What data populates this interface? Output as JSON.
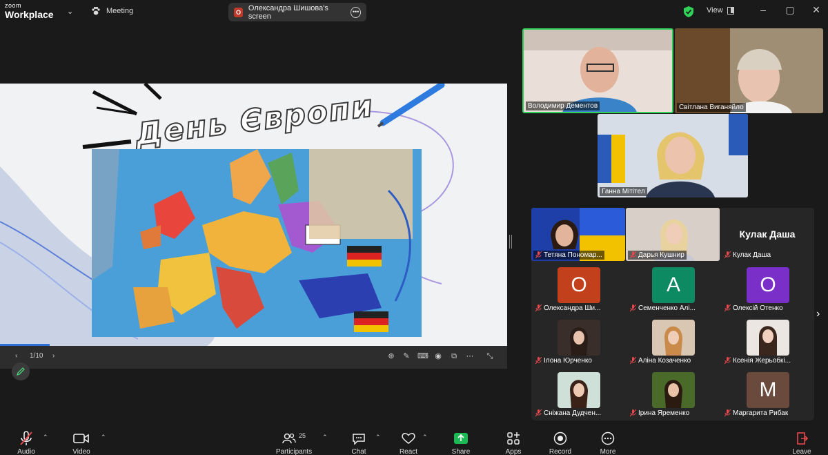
{
  "titlebar": {
    "logo_top": "zoom",
    "logo_bottom": "Workplace",
    "meeting_label": "Meeting",
    "share_badge": "O",
    "share_label": "Олександра Шишова's screen",
    "view_label": "View",
    "security_color": "#30d158"
  },
  "slide": {
    "title": "День Європи",
    "page": "1/10"
  },
  "speakers": [
    {
      "name": "Володимир Дементов"
    },
    {
      "name": "Світлана Виганяйло"
    },
    {
      "name": "Ганна Мітітел"
    }
  ],
  "gallery": {
    "top_row": [
      {
        "name": "Тетяна Пономар..."
      },
      {
        "name": "Дарья Кушнир"
      },
      {
        "name": "Кулак Даша",
        "title": "Кулак Даша"
      }
    ],
    "row2": [
      {
        "name": "Олександра Ши...",
        "initial": "O",
        "color": "#c2401c"
      },
      {
        "name": "Семенченко Алі...",
        "initial": "A",
        "color": "#0e8a63"
      },
      {
        "name": "Олексій Отенко",
        "initial": "O",
        "color": "#7a2fc9"
      }
    ],
    "row3": [
      {
        "name": "Ілона Юрченко"
      },
      {
        "name": "Аліна Козаченко"
      },
      {
        "name": "Ксенія Жерьобкі..."
      }
    ],
    "row4": [
      {
        "name": "Сніжана Дудчен..."
      },
      {
        "name": "Ірина Яременко"
      },
      {
        "name": "Маргарита Рибак",
        "initial": "M",
        "color": "#6a4a3c"
      }
    ]
  },
  "toolbar": {
    "audio": "Audio",
    "video": "Video",
    "participants": "Participants",
    "participants_count": "25",
    "chat": "Chat",
    "react": "React",
    "share": "Share",
    "apps": "Apps",
    "record": "Record",
    "more": "More",
    "leave": "Leave",
    "share_color": "#1db954",
    "leave_color": "#e5484d"
  }
}
